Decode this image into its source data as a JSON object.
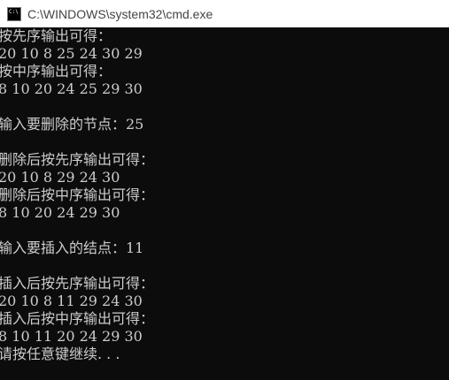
{
  "window": {
    "title": "C:\\WINDOWS\\system32\\cmd.exe",
    "icon_text": "C:\\"
  },
  "console": {
    "lines": [
      "按先序输出可得：",
      "20 10 8 25 24 30 29",
      "按中序输出可得：",
      "8 10 20 24 25 29 30",
      "",
      "输入要删除的节点：25",
      "",
      "删除后按先序输出可得：",
      "20 10 8 29 24 30",
      "删除后按中序输出可得：",
      "8 10 20 24 29 30",
      "",
      "输入要插入的结点：11",
      "",
      "插入后按先序输出可得：",
      "20 10 8 11 29 24 30",
      "插入后按中序输出可得：",
      "8 10 11 20 24 29 30",
      "请按任意键继续. . ."
    ]
  },
  "colors": {
    "background": "#0c0c0c",
    "text": "#cccccc",
    "titlebar": "#ffffff"
  }
}
